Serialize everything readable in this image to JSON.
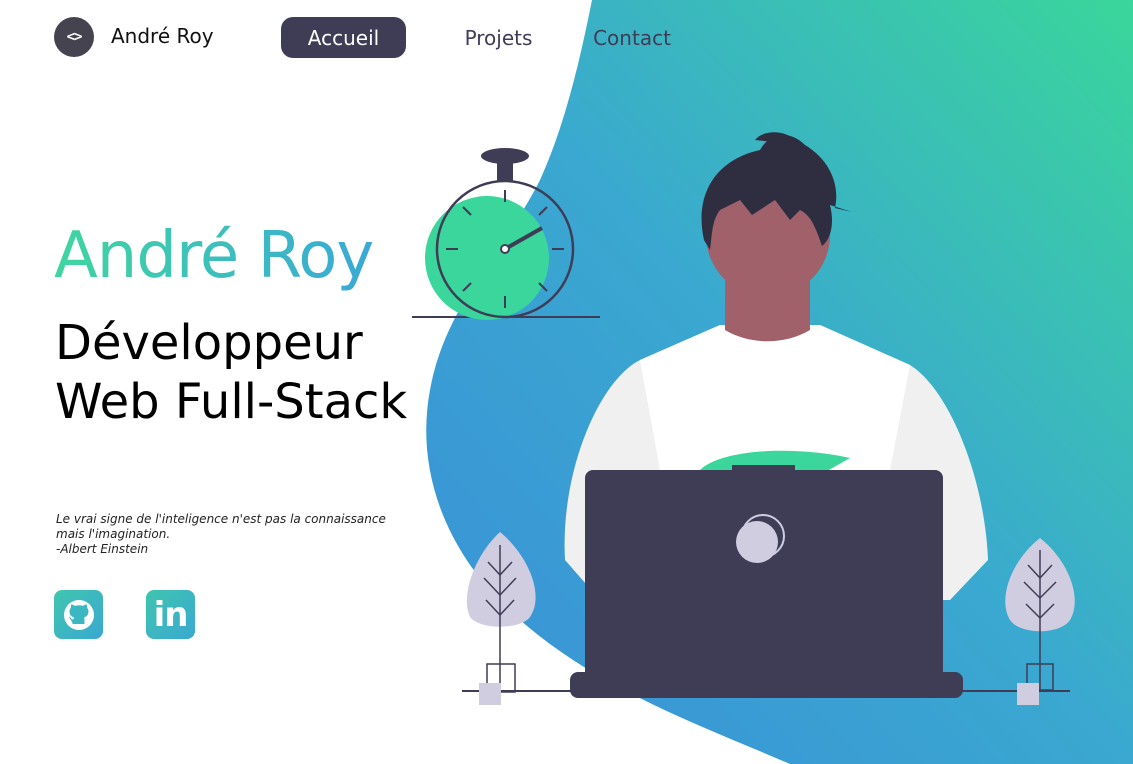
{
  "header": {
    "logo_glyph": "<>",
    "brand": "André Roy",
    "nav": [
      {
        "label": "Accueil",
        "active": true
      },
      {
        "label": "Projets",
        "active": false
      },
      {
        "label": "Contact",
        "active": false
      }
    ]
  },
  "hero": {
    "name": "André Roy",
    "title": "Développeur Web Full-Stack",
    "quote_line1": "Le vrai signe de l'inteligence n'est pas la connaissance",
    "quote_line2": "mais l'imagination.",
    "quote_author": "-Albert Einstein"
  },
  "social": [
    {
      "icon": "github-icon"
    },
    {
      "icon": "linkedin-icon",
      "glyph": "in"
    }
  ],
  "colors": {
    "accent_green": "#3fd6a0",
    "accent_blue": "#3aa9d6",
    "dark": "#3f3d56",
    "plant": "#d0cde1"
  }
}
